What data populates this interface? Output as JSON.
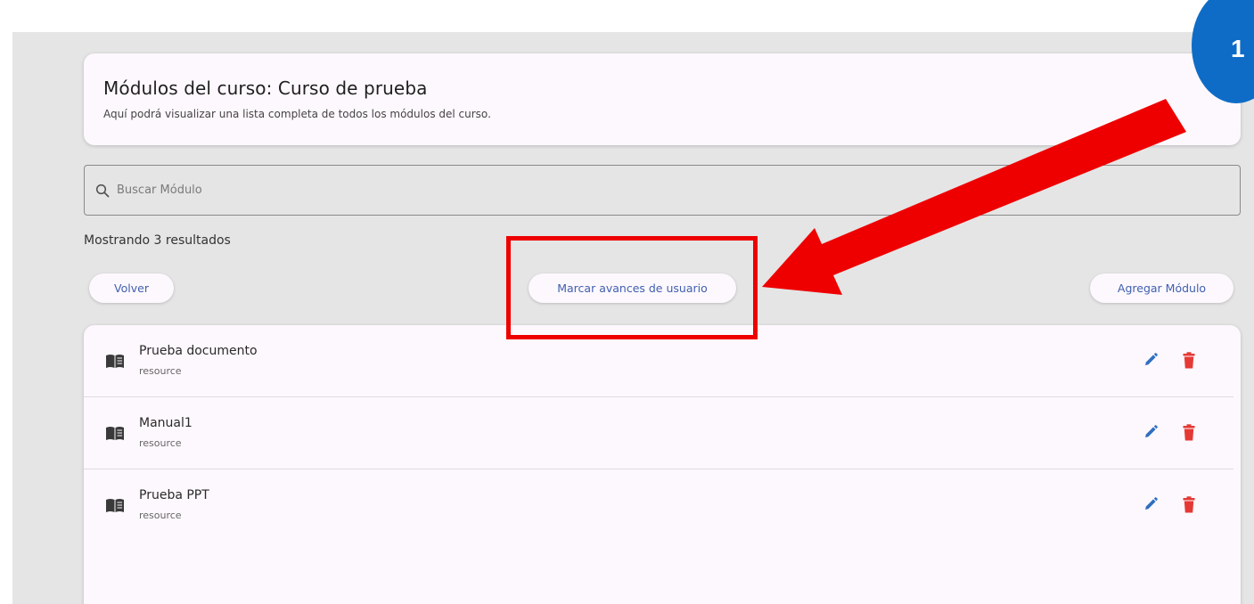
{
  "header": {
    "title": "Módulos del curso: Curso de prueba",
    "subtitle": "Aquí podrá visualizar una lista completa de todos los módulos del curso."
  },
  "search": {
    "placeholder": "Buscar Módulo",
    "value": "",
    "icon": "search-icon"
  },
  "results": {
    "text": "Mostrando 3 resultados"
  },
  "actions": {
    "back_label": "Volver",
    "progress_label": "Marcar avances de usuario",
    "add_label": "Agregar Módulo"
  },
  "modules": [
    {
      "title": "Prueba documento",
      "type": "resource"
    },
    {
      "title": "Manual1",
      "type": "resource"
    },
    {
      "title": "Prueba PPT",
      "type": "resource"
    }
  ],
  "annotation": {
    "step_number": "1",
    "highlight_color": "#ee0000",
    "badge_color": "#0e6cc7"
  },
  "colors": {
    "accent": "#3f5fb0",
    "edit_icon": "#2f6fc0",
    "delete_icon": "#e53935",
    "card_background": "#fdf8fd",
    "page_background": "#e5e5e5"
  }
}
